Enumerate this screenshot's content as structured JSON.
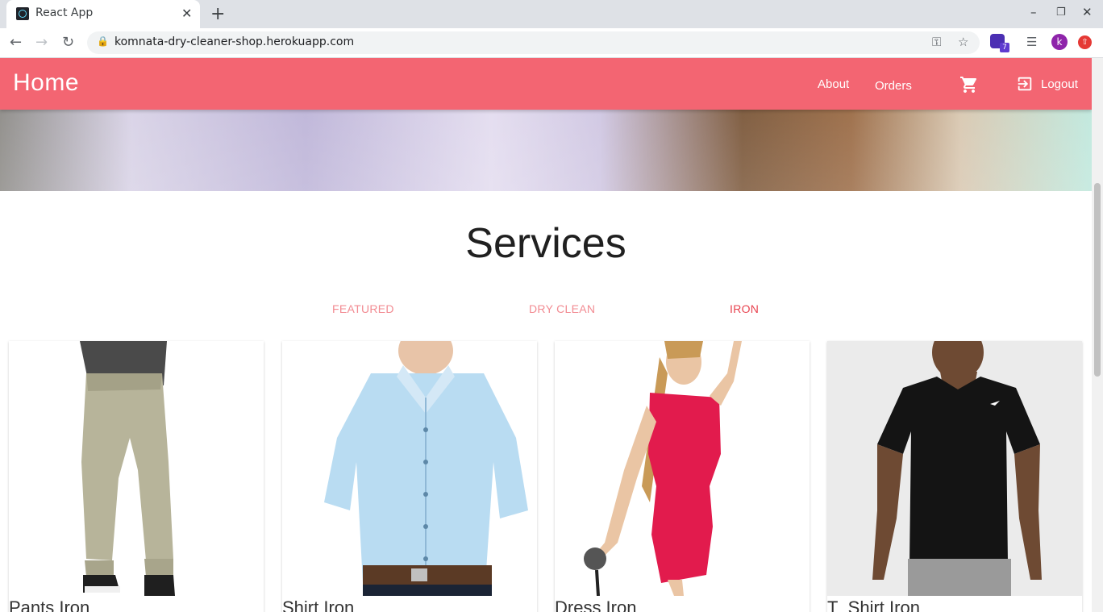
{
  "browser": {
    "tab_title": "React App",
    "tab_close": "✕",
    "new_tab": "+",
    "url": "komnata-dry-cleaner-shop.herokuapp.com",
    "profile_initial": "k",
    "extension_badge": "7",
    "window_controls": [
      "–",
      "❐",
      "✕"
    ]
  },
  "appbar": {
    "brand": "Home",
    "links": [
      "About",
      "Orders"
    ],
    "logout": "Logout",
    "color": "#f36572"
  },
  "main": {
    "title": "Services",
    "tabs": [
      {
        "label": "FEATURED",
        "active": false
      },
      {
        "label": "DRY CLEAN",
        "active": false
      },
      {
        "label": "IRON",
        "active": true
      }
    ],
    "tab_color": "#f28b92",
    "tab_active_color": "#e8434f",
    "cards": [
      {
        "label": "Pants Iron",
        "icon": "pants-image"
      },
      {
        "label": "Shirt Iron",
        "icon": "shirt-image"
      },
      {
        "label": "Dress Iron",
        "icon": "dress-image"
      },
      {
        "label": "T_Shirt Iron",
        "icon": "tshirt-image"
      }
    ]
  }
}
